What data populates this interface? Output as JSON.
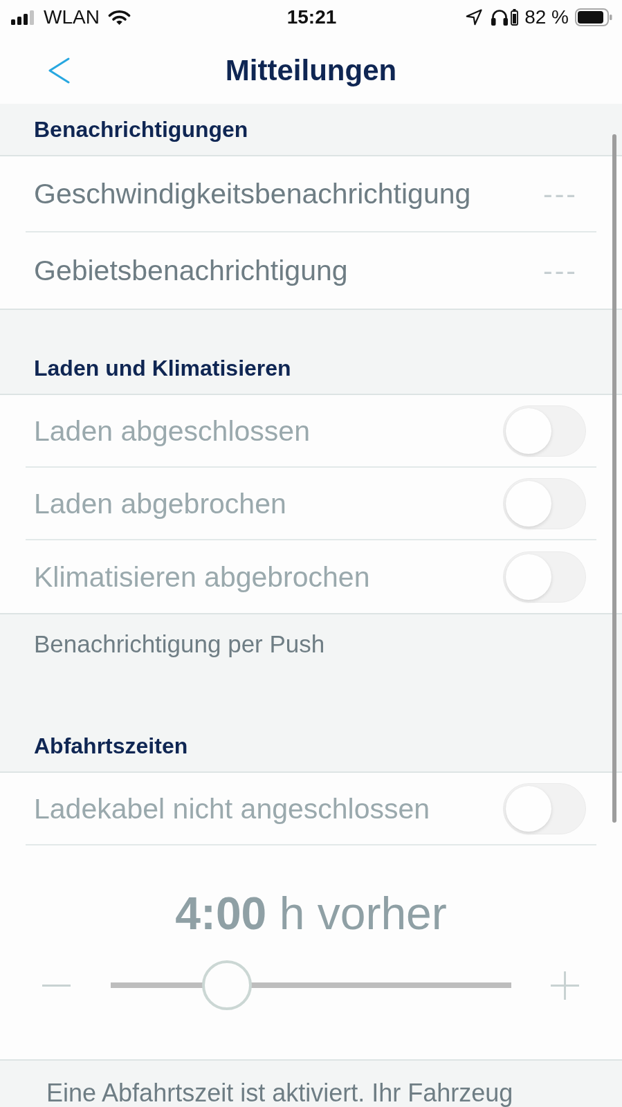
{
  "status_bar": {
    "carrier": "WLAN",
    "time": "15:21",
    "battery": "82 %"
  },
  "header": {
    "title": "Mitteilungen"
  },
  "sections": [
    {
      "title": "Benachrichtigungen",
      "rows": [
        {
          "kind": "value",
          "label": "Geschwindigkeitsbenachrichtigung",
          "value": "---",
          "disabled": false
        },
        {
          "kind": "value",
          "label": "Gebietsbenachrichtigung",
          "value": "---",
          "disabled": false
        }
      ]
    },
    {
      "title": "Laden und Klimatisieren",
      "rows": [
        {
          "kind": "toggle",
          "label": "Laden abgeschlossen",
          "on": false,
          "disabled": true
        },
        {
          "kind": "toggle",
          "label": "Laden abgebrochen",
          "on": false,
          "disabled": true
        },
        {
          "kind": "toggle",
          "label": "Klimatisieren abgebrochen",
          "on": false,
          "disabled": true
        }
      ],
      "footer": "Benachrichtigung per Push"
    },
    {
      "title": "Abfahrtszeiten",
      "rows": [
        {
          "kind": "toggle",
          "label": "Ladekabel nicht angeschlossen",
          "on": false,
          "disabled": true
        }
      ],
      "time_slider": {
        "reading": "**4:00** h vorher",
        "level": 0.29
      }
    }
  ],
  "note": "Eine Abfahrtszeit ist aktiviert. Ihr Fahrzeug"
}
